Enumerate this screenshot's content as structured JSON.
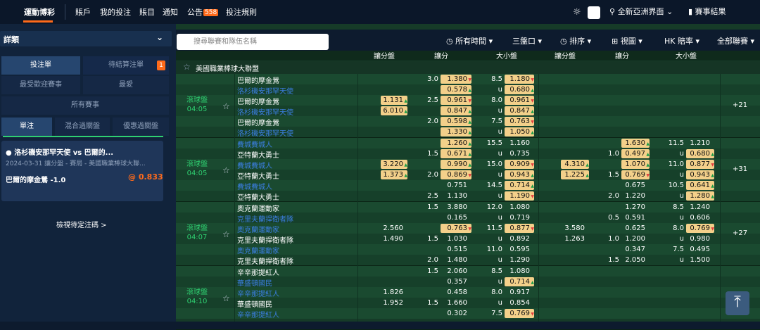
{
  "nav": {
    "brand": "運動博彩",
    "items": [
      "賬戶",
      "我的投注",
      "賬目",
      "通知",
      "公告"
    ],
    "announce_badge": "558",
    "rules": "投注規則",
    "view": "全新亞洲界面",
    "results": "賽事結果"
  },
  "left": {
    "header": "詳類",
    "tabs": {
      "bets": "投注單",
      "pending": "待結算注單",
      "pending_badge": "1",
      "popular": "最受歡迎賽事",
      "fav": "最愛",
      "all": "所有賽事",
      "single": "單注",
      "parlay": "混合過關盤",
      "promo": "優惠過關盤"
    },
    "card": {
      "match": "洛杉磯安那罕天使 vs 巴爾的...",
      "info": "2024-03-31 讓分盤 - 賽局 - 美國職業棒球大聯...",
      "pick": "巴爾的摩金鶯 -1.0",
      "odds": "@ 0.833"
    },
    "pending_link": "檢視待定注碼 >"
  },
  "toolbar": {
    "search_placeholder": "搜尋聯賽和隊伍名稱",
    "time": "所有時間 ▾",
    "odds_type": "三盤口 ▾",
    "sort": "排序 ▾",
    "view": "視圖 ▾",
    "hk": "HK 賠率 ▾",
    "league": "全部聯賽 ▾"
  },
  "header": {
    "c1": "讓分盤",
    "c2": "讓分",
    "c3": "大小盤"
  },
  "league_name": "美國職業棒球大聯盟",
  "games": [
    {
      "status": "滾球盤",
      "time": "04:05",
      "more": "+21",
      "rows": [
        {
          "team": "巴爾的摩金鶯",
          "blue": false,
          "hcp": "3.0",
          "odds": "1.380",
          "ou": "8.5",
          "ouo": "1.180"
        },
        {
          "team": "洛杉磯安那罕天使",
          "blue": true,
          "hcp": "",
          "odds": "0.578",
          "ou": "u",
          "ouo": "0.680"
        },
        {
          "team": "巴爾的摩金鶯",
          "blue": false,
          "ml": "1.131",
          "hcp": "2.5",
          "odds": "0.961",
          "ou": "8.0",
          "ouo": "0.961"
        },
        {
          "team": "洛杉磯安那罕天使",
          "blue": true,
          "ml": "6.010",
          "hcp": "",
          "odds": "0.847",
          "ou": "u",
          "ouo": "0.847"
        },
        {
          "team": "巴爾的摩金鶯",
          "blue": false,
          "hcp": "2.0",
          "odds": "0.598",
          "ou": "7.5",
          "ouo": "0.763"
        },
        {
          "team": "洛杉磯安那罕天使",
          "blue": true,
          "hcp": "",
          "odds": "1.330",
          "ou": "u",
          "ouo": "1.050"
        }
      ]
    },
    {
      "status": "滾球盤",
      "time": "04:05",
      "more": "+31",
      "rows": [
        {
          "team": "費城費城人",
          "blue": true,
          "hcp": "",
          "odds": "1.260",
          "ou": "15.5",
          "ouo": "1.160",
          "h2": "1.630",
          "ou2": "11.5",
          "ouo2": "1.210"
        },
        {
          "team": "亞特蘭大勇士",
          "blue": false,
          "hcp": "1.5",
          "odds": "0.671",
          "ou": "u",
          "ouo": "0.735",
          "hcp2": "1.0",
          "h2": "0.497",
          "ou2": "u",
          "ouo2": "0.680"
        },
        {
          "team": "費城費城人",
          "blue": true,
          "ml": "3.220",
          "hcp": "",
          "odds": "0.990",
          "ou": "15.0",
          "ouo": "0.909",
          "ml2": "4.310",
          "h2": "1.070",
          "ou2": "11.0",
          "ouo2": "0.877"
        },
        {
          "team": "亞特蘭大勇士",
          "blue": false,
          "ml": "1.373",
          "hcp": "2.0",
          "odds": "0.869",
          "ou": "u",
          "ouo": "0.943",
          "ml2": "1.225",
          "hcp2": "1.5",
          "h2": "0.769",
          "ou2": "u",
          "ouo2": "0.943"
        },
        {
          "team": "費城費城人",
          "blue": true,
          "hcp": "",
          "odds": "0.751",
          "ou": "14.5",
          "ouo": "0.714",
          "h2": "0.675",
          "ou2": "10.5",
          "ouo2": "0.641"
        },
        {
          "team": "亞特蘭大勇士",
          "blue": false,
          "hcp": "2.5",
          "odds": "1.130",
          "ou": "u",
          "ouo": "1.190",
          "hcp2": "2.0",
          "h2": "1.220",
          "ou2": "u",
          "ouo2": "1.280"
        }
      ]
    },
    {
      "status": "滾球盤",
      "time": "04:07",
      "more": "+27",
      "rows": [
        {
          "team": "奧克蘭運動家",
          "blue": false,
          "hcp": "1.5",
          "odds": "3.880",
          "ou": "12.0",
          "ouo": "1.080",
          "h2": "1.270",
          "ou2": "8.5",
          "ouo2": "1.240"
        },
        {
          "team": "克里夫蘭捍衛者隊",
          "blue": true,
          "hcp": "",
          "odds": "0.165",
          "ou": "u",
          "ouo": "0.719",
          "hcp2": "0.5",
          "h2": "0.591",
          "ou2": "u",
          "ouo2": "0.606"
        },
        {
          "team": "奧克蘭運動家",
          "blue": true,
          "ml": "2.560",
          "hcp": "",
          "odds": "0.763",
          "ou": "11.5",
          "ouo": "0.877",
          "ml2": "3.580",
          "h2": "0.625",
          "ou2": "8.0",
          "ouo2": "0.769"
        },
        {
          "team": "克里夫蘭捍衛者隊",
          "blue": false,
          "ml": "1.490",
          "hcp": "1.5",
          "odds": "1.030",
          "ou": "u",
          "ouo": "0.892",
          "ml2": "1.263",
          "hcp2": "1.0",
          "h2": "1.200",
          "ou2": "u",
          "ouo2": "0.980"
        },
        {
          "team": "奧克蘭運動家",
          "blue": true,
          "hcp": "",
          "odds": "0.515",
          "ou": "11.0",
          "ouo": "0.595",
          "h2": "0.347",
          "ou2": "7.5",
          "ouo2": "0.495"
        },
        {
          "team": "克里夫蘭捍衛者隊",
          "blue": false,
          "hcp": "2.0",
          "odds": "1.480",
          "ou": "u",
          "ouo": "1.290",
          "hcp2": "1.5",
          "h2": "2.050",
          "ou2": "u",
          "ouo2": "1.500"
        }
      ]
    },
    {
      "status": "滾球盤",
      "time": "04:10",
      "more": "",
      "rows": [
        {
          "team": "辛辛那提紅人",
          "blue": false,
          "hcp": "1.5",
          "odds": "2.060",
          "ou": "8.5",
          "ouo": "1.080"
        },
        {
          "team": "華盛頓國民",
          "blue": true,
          "hcp": "",
          "odds": "0.357",
          "ou": "u",
          "ouo": "0.714"
        },
        {
          "team": "辛辛那提紅人",
          "blue": true,
          "ml": "1.826",
          "hcp": "",
          "odds": "0.458",
          "ou": "8.0",
          "ouo": "0.917"
        },
        {
          "team": "華盛頓國民",
          "blue": false,
          "ml": "1.952",
          "hcp": "1.5",
          "odds": "1.660",
          "ou": "u",
          "ouo": "0.854"
        },
        {
          "team": "辛辛那提紅人",
          "blue": true,
          "hcp": "",
          "odds": "0.302",
          "ou": "7.5",
          "ouo": "0.769"
        }
      ]
    }
  ]
}
